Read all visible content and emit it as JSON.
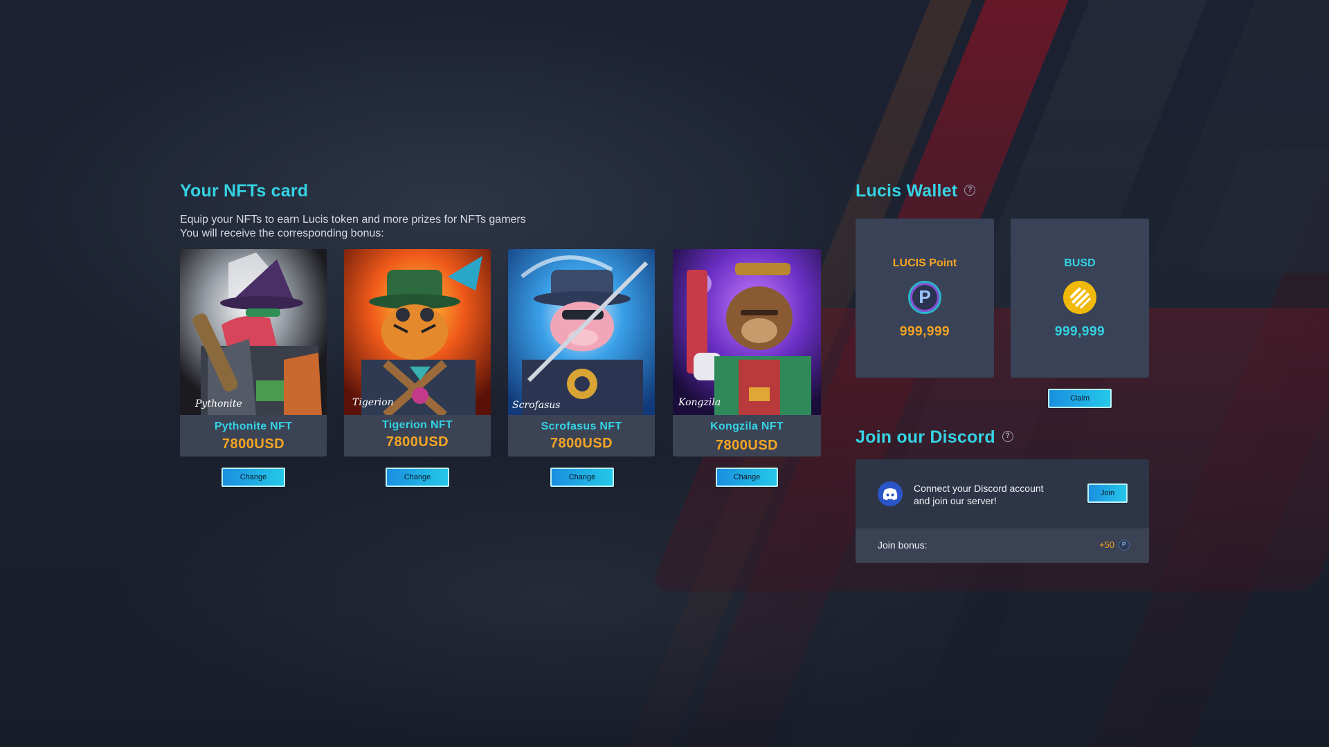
{
  "nfts_section": {
    "title": "Your NFTs card",
    "description_line1": "Equip your NFTs to earn Lucis token and more prizes for NFTs gamers",
    "description_line2": "You will receive the corresponding bonus:",
    "cards": [
      {
        "name": "Pythonite NFT",
        "price": "7800USD",
        "button": "Change",
        "signature": "Pythonite"
      },
      {
        "name": "Tigerion NFT",
        "price": "7800USD",
        "button": "Change",
        "signature": "Tigerion"
      },
      {
        "name": "Scrofasus NFT",
        "price": "7800USD",
        "button": "Change",
        "signature": "Scrofasus"
      },
      {
        "name": "Kongzila NFT",
        "price": "7800USD",
        "button": "Change",
        "signature": "Kongzila"
      }
    ]
  },
  "wallet": {
    "title": "Lucis Wallet",
    "help_icon": "?",
    "lucis": {
      "label": "LUCIS Point",
      "amount": "999,999",
      "coin_letter": "P",
      "color": "#f6a623"
    },
    "busd": {
      "label": "BUSD",
      "amount": "999,999",
      "color": "#35d3e4"
    },
    "claim_button": "Claim"
  },
  "discord": {
    "title": "Join our Discord",
    "help_icon": "?",
    "text_line1": "Connect your Discord account",
    "text_line2": "and join our server!",
    "join_button": "Join",
    "bonus_label": "Join bonus:",
    "bonus_value": "+50",
    "bonus_coin_letter": "P"
  },
  "colors": {
    "accent": "#35d3e4",
    "price": "#f6a623",
    "card_bg": "#3b4355",
    "page_bg": "#1c2230"
  }
}
